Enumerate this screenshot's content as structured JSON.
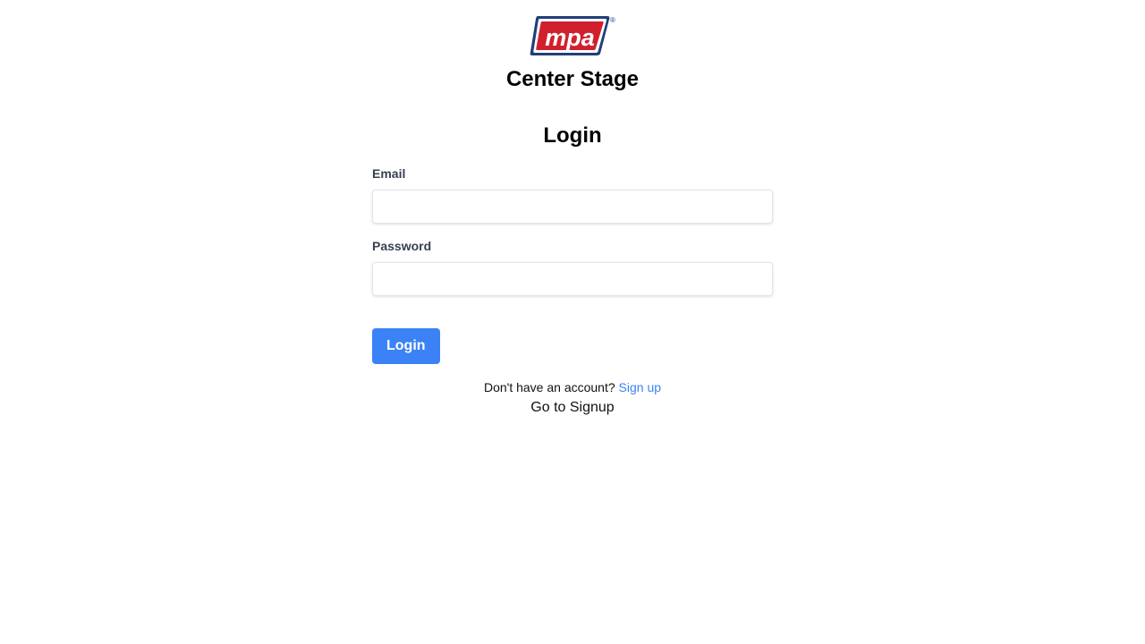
{
  "brand": {
    "logo_text": "mpa",
    "logo_mark": "®",
    "app_title": "Center Stage",
    "colors": {
      "logo_blue": "#1f3f7a",
      "logo_red": "#d0202e"
    }
  },
  "login_form": {
    "title": "Login",
    "email": {
      "label": "Email",
      "value": "",
      "placeholder": ""
    },
    "password": {
      "label": "Password",
      "value": "",
      "placeholder": ""
    },
    "submit_label": "Login",
    "signup_prompt": "Don't have an account?",
    "signup_link_label": "Sign up",
    "goto_signup_label": "Go to Signup"
  },
  "colors": {
    "accent": "#3b82f6",
    "label_text": "#374151",
    "input_border": "#e2e4e8"
  }
}
